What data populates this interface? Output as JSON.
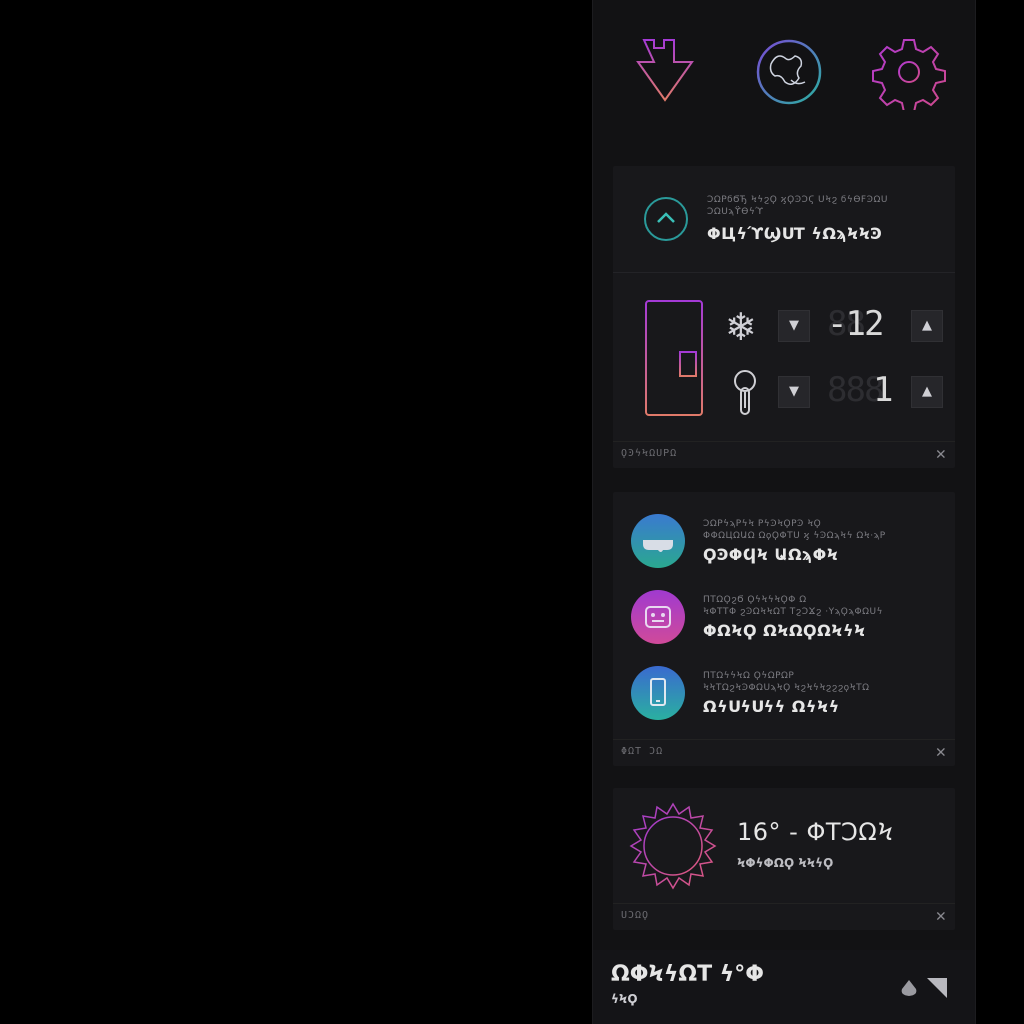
{
  "panel": {
    "top_icons": [
      "download-arrow-icon",
      "globe-icon",
      "gear-icon"
    ],
    "fridge_card": {
      "icon": "chevron-up-icon",
      "subtitle": "ϽΩРϭϬЂ ϞϟϩϘ ϗϘϿϽϚ ՍϞϩ ϭϟѲϜϿΩՍ ϽΩՍϡϔѲϟϓ",
      "title": "ΦЦϟϓϢՍΤ ϟΩϡϞϞϿ",
      "freezer": {
        "icon": "snowflake-icon",
        "ghost": "88",
        "value": "-12",
        "decrement": "▼",
        "increment": "▲"
      },
      "fridge": {
        "icon": "thermometer-icon",
        "ghost": "888",
        "value": "1",
        "decrement": "▼",
        "increment": "▲"
      },
      "footer": "ϘϿϟϞΩՍРΩ",
      "close": "✕"
    },
    "shop_card": {
      "items": [
        {
          "icon": "cloud-icon",
          "line1": "ϽΩРϟϡРϟϞ РϟϿϞϘРϿ ϞϘ",
          "line2": "ΦΦΩЦΩԱΩ ΩϙϘΦΤՍ ϗ ϟϿΩϡϞϟ ΩϞ·ϡР",
          "title": "ϘϿΦϤϞ ԱΩϡΦϞ"
        },
        {
          "icon": "robot-icon",
          "line1": "ΠΤΩϘϩϬ ϘϟϞϟϞϘΦ Ω",
          "line2": "ϞΦΤΤΦ ϩϿΩϞϞΩΤ ΤϩϽϪϩ ·ΥϡϘϡΦΩՍϟ",
          "title": "ΦΩϞϘ ΩϞΩϘΩϞϟϞ"
        },
        {
          "icon": "phone-icon",
          "line1": "ΠΤΩϟϟϞΩ ϘϟΩРΩР",
          "line2": "ϞϞΤΩϩϞϿΦΩՍϡϞϘ ϞϩϞϟϞϩϩϩϙϞΤΩ",
          "title": "ΩϟՍϟՍϟϟ ΩϟϞϟ"
        }
      ],
      "footer": "ΦΩΤ ϽΩ",
      "close": "✕"
    },
    "weather_card": {
      "icon": "sun-icon",
      "temp": "16° - ΦΤϽΩϞ",
      "subtitle": "ϞΦϟΦΩϘ ϞϞϟϘ",
      "footer": "ՍϽΩϘ",
      "close": "✕"
    },
    "bottom": {
      "title": "ΩΦϞϟΩΤ ϟ°Φ",
      "subtitle": "ϟϞϘ",
      "icons": [
        "cloud-drop-icon",
        "signal-icon"
      ]
    },
    "colors": {
      "panel_bg": "#121214",
      "card_bg": "#18181b",
      "accent_purple": "#b53ad6",
      "accent_teal": "#2a9a9a"
    }
  }
}
